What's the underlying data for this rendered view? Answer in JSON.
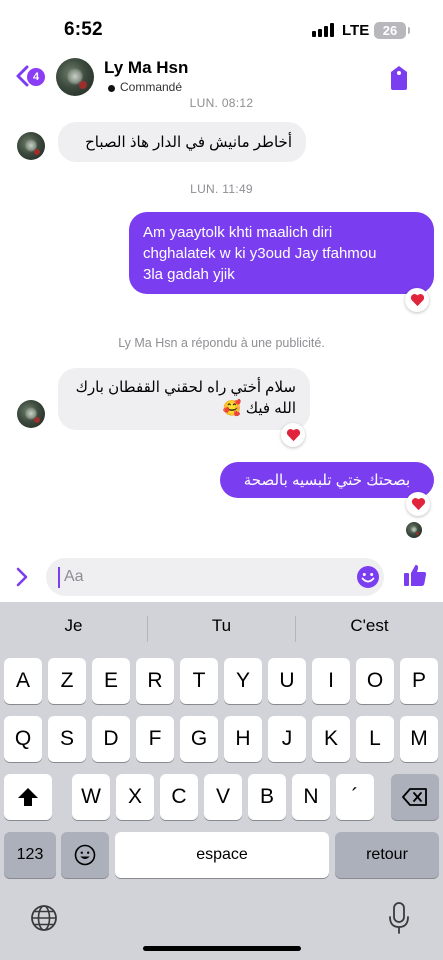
{
  "status_bar": {
    "time": "6:52",
    "network": "LTE",
    "battery": "26"
  },
  "header": {
    "unread_count": "4",
    "contact_name": "Ly Ma Hsn",
    "contact_status": "Commandé"
  },
  "chat": {
    "timestamp_top": "LUN. 08:12",
    "msg1": "أخاطر مانيش في الدار هاذ الصباح",
    "timestamp_mid": "LUN. 11:49",
    "msg2_line1": "Am yaaytolk khti maalich diri",
    "msg2_line2": "chghalatek w ki y3oud Jay tfahmou",
    "msg2_line3": "3la gadah yjik",
    "reply_note": "Ly Ma Hsn a répondu à une publicité.",
    "msg3_line1": "سلام أختي راه لحقني القفطان بارك",
    "msg3_line2": "الله فيك 🥰",
    "msg4": "بصحتك ختي تلبسيه بالصحة"
  },
  "composer": {
    "placeholder": "Aa"
  },
  "keyboard": {
    "suggestions": [
      "Je",
      "Tu",
      "C'est"
    ],
    "row1": [
      "A",
      "Z",
      "E",
      "R",
      "T",
      "Y",
      "U",
      "I",
      "O",
      "P"
    ],
    "row2": [
      "Q",
      "S",
      "D",
      "F",
      "G",
      "H",
      "J",
      "K",
      "L",
      "M"
    ],
    "row3": [
      "W",
      "X",
      "C",
      "V",
      "B",
      "N",
      "´"
    ],
    "numbers_label": "123",
    "space_label": "espace",
    "return_label": "retour"
  },
  "colors": {
    "accent": "#7b3df0",
    "incoming_bubble": "#efeff1",
    "keyboard_bg": "#d1d3d9"
  }
}
